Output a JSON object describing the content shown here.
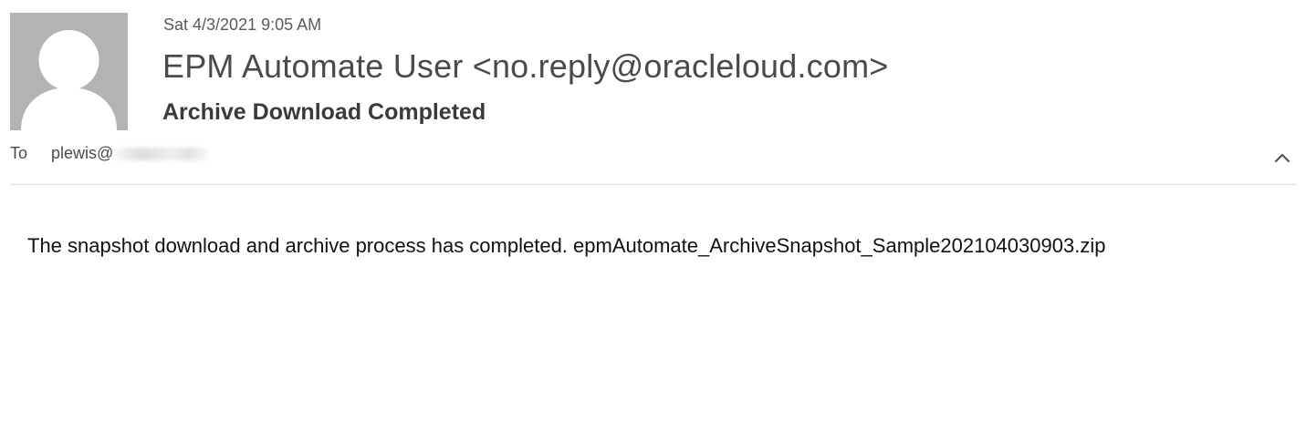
{
  "email": {
    "date": "Sat 4/3/2021 9:05 AM",
    "sender": "EPM Automate User <no.reply@oracleloud.com>",
    "subject": "Archive Download Completed",
    "to_label": "To",
    "recipient_visible": "plewis@",
    "body": "The snapshot download and archive process has completed. epmAutomate_ArchiveSnapshot_Sample202104030903.zip"
  },
  "icons": {
    "avatar": "default-person-avatar-icon",
    "collapse": "chevron-up-icon"
  },
  "colors": {
    "avatar_bg": "#b3b3b3",
    "avatar_figure": "#ffffff",
    "divider": "#dcdcdc"
  }
}
